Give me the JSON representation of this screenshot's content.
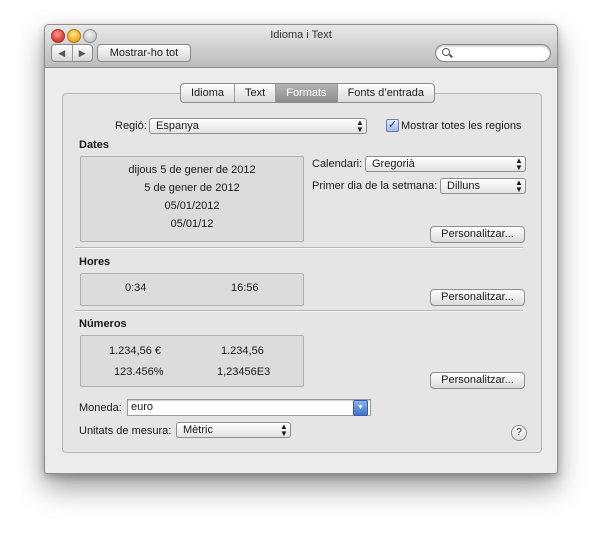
{
  "window": {
    "title": "Idioma i Text",
    "nav_back": "◀",
    "nav_forward": "▶",
    "show_all_label": "Mostrar-ho tot",
    "search_placeholder": ""
  },
  "tabs": [
    {
      "label": "Idioma",
      "selected": false
    },
    {
      "label": "Text",
      "selected": false
    },
    {
      "label": "Formats",
      "selected": true
    },
    {
      "label": "Fonts d’entrada",
      "selected": false
    }
  ],
  "region": {
    "label": "Regió:",
    "value": "Espanya",
    "show_all_checked": true,
    "show_all_label": "Mostrar totes les regions"
  },
  "dates": {
    "heading": "Dates",
    "samples": [
      "dijous 5 de gener de 2012",
      "5 de gener de 2012",
      "05/01/2012",
      "05/01/12"
    ],
    "calendar_label": "Calendari:",
    "calendar_value": "Gregorià",
    "first_day_label": "Primer dia de la setmana:",
    "first_day_value": "Dilluns",
    "customize_label": "Personalitzar..."
  },
  "times": {
    "heading": "Hores",
    "samples": [
      "0:34",
      "16:56"
    ],
    "customize_label": "Personalitzar..."
  },
  "numbers": {
    "heading": "Números",
    "samples": [
      "1.234,56 €",
      "1.234,56",
      "123.456%",
      "1,23456E3"
    ],
    "customize_label": "Personalitzar..."
  },
  "currency": {
    "label": "Moneda:",
    "value": "euro"
  },
  "units": {
    "label": "Unitats de mesura:",
    "value": "Mètric"
  },
  "help_label": "?",
  "colors": {
    "tab_selected": "#9a9a9a",
    "combo_button": "#3c73c9"
  }
}
